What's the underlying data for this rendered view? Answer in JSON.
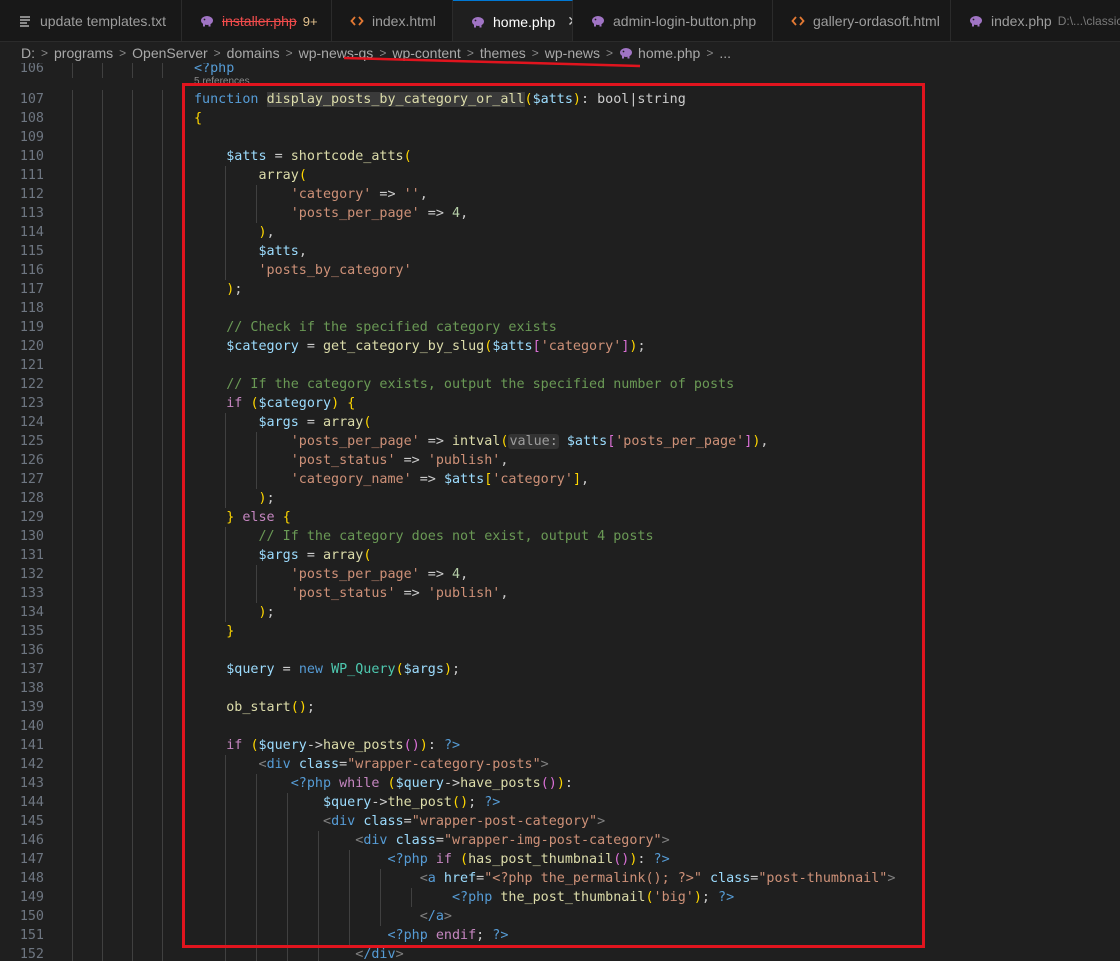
{
  "tabs": [
    {
      "label": "update templates.txt",
      "icon": "text-file-icon",
      "active": false,
      "deleted": false,
      "badge": "",
      "path": ""
    },
    {
      "label": "installer.php",
      "icon": "php-elephant-icon",
      "active": false,
      "deleted": true,
      "badge": "9+",
      "path": ""
    },
    {
      "label": "index.html",
      "icon": "html-brackets-icon",
      "active": false,
      "deleted": false,
      "badge": "",
      "path": ""
    },
    {
      "label": "home.php",
      "icon": "php-elephant-icon",
      "active": true,
      "deleted": false,
      "badge": "",
      "path": "",
      "close": "✕"
    },
    {
      "label": "admin-login-button.php",
      "icon": "php-elephant-icon",
      "active": false,
      "deleted": false,
      "badge": "",
      "path": ""
    },
    {
      "label": "gallery-ordasoft.html",
      "icon": "html-brackets-icon",
      "active": false,
      "deleted": false,
      "badge": "",
      "path": ""
    },
    {
      "label": "index.php",
      "icon": "php-elephant-icon",
      "active": false,
      "deleted": false,
      "badge": "",
      "path": "D:\\...\\classic-b"
    }
  ],
  "breadcrumb": {
    "items": [
      "D:",
      "programs",
      "OpenServer",
      "domains",
      "wp-news-qs",
      "wp-content",
      "themes",
      "wp-news",
      "home.php",
      "..."
    ],
    "separator": ">"
  },
  "editor": {
    "codelens": "5 references",
    "lines": [
      {
        "n": "106",
        "t": "<?php"
      },
      {
        "n": "107",
        "t": "function display_posts_by_category_or_all($atts): bool|string"
      },
      {
        "n": "108",
        "t": "{"
      },
      {
        "n": "109",
        "t": ""
      },
      {
        "n": "110",
        "t": "    $atts = shortcode_atts("
      },
      {
        "n": "111",
        "t": "        array("
      },
      {
        "n": "112",
        "t": "            'category' => '',"
      },
      {
        "n": "113",
        "t": "            'posts_per_page' => 4,"
      },
      {
        "n": "114",
        "t": "        ),"
      },
      {
        "n": "115",
        "t": "        $atts,"
      },
      {
        "n": "116",
        "t": "        'posts_by_category'"
      },
      {
        "n": "117",
        "t": "    );"
      },
      {
        "n": "118",
        "t": ""
      },
      {
        "n": "119",
        "t": "    // Check if the specified category exists"
      },
      {
        "n": "120",
        "t": "    $category = get_category_by_slug($atts['category']);"
      },
      {
        "n": "121",
        "t": ""
      },
      {
        "n": "122",
        "t": "    // If the category exists, output the specified number of posts"
      },
      {
        "n": "123",
        "t": "    if ($category) {"
      },
      {
        "n": "124",
        "t": "        $args = array("
      },
      {
        "n": "125",
        "t": "            'posts_per_page' => intval(value: $atts['posts_per_page']),"
      },
      {
        "n": "126",
        "t": "            'post_status' => 'publish',"
      },
      {
        "n": "127",
        "t": "            'category_name' => $atts['category'],"
      },
      {
        "n": "128",
        "t": "        );"
      },
      {
        "n": "129",
        "t": "    } else {"
      },
      {
        "n": "130",
        "t": "        // If the category does not exist, output 4 posts"
      },
      {
        "n": "131",
        "t": "        $args = array("
      },
      {
        "n": "132",
        "t": "            'posts_per_page' => 4,"
      },
      {
        "n": "133",
        "t": "            'post_status' => 'publish',"
      },
      {
        "n": "134",
        "t": "        );"
      },
      {
        "n": "135",
        "t": "    }"
      },
      {
        "n": "136",
        "t": ""
      },
      {
        "n": "137",
        "t": "    $query = new WP_Query($args);"
      },
      {
        "n": "138",
        "t": ""
      },
      {
        "n": "139",
        "t": "    ob_start();"
      },
      {
        "n": "140",
        "t": ""
      },
      {
        "n": "141",
        "t": "    if ($query->have_posts()): ?>"
      },
      {
        "n": "142",
        "t": "        <div class=\"wrapper-category-posts\">"
      },
      {
        "n": "143",
        "t": "            <?php while ($query->have_posts()):"
      },
      {
        "n": "144",
        "t": "                $query->the_post(); ?>"
      },
      {
        "n": "145",
        "t": "                <div class=\"wrapper-post-category\">"
      },
      {
        "n": "146",
        "t": "                    <div class=\"wrapper-img-post-category\">"
      },
      {
        "n": "147",
        "t": "                        <?php if (has_post_thumbnail()): ?>"
      },
      {
        "n": "148",
        "t": "                            <a href=\"<?php the_permalink(); ?>\" class=\"post-thumbnail\">"
      },
      {
        "n": "149",
        "t": "                                <?php the_post_thumbnail('big'); ?>"
      },
      {
        "n": "150",
        "t": "                            </a>"
      },
      {
        "n": "151",
        "t": "                        <?php endif; ?>"
      },
      {
        "n": "152",
        "t": "                    </div>"
      }
    ]
  },
  "colors": {
    "editor_bg": "#1f1f1f",
    "tabbar_bg": "#181818",
    "annotation_red": "#e0141e",
    "keyword": "#569cd6",
    "control": "#c586c0",
    "function": "#dcdcaa",
    "variable": "#9cdcfe",
    "string": "#ce9178",
    "number": "#b5cea8",
    "comment": "#6a9955",
    "class": "#4ec9b0"
  }
}
